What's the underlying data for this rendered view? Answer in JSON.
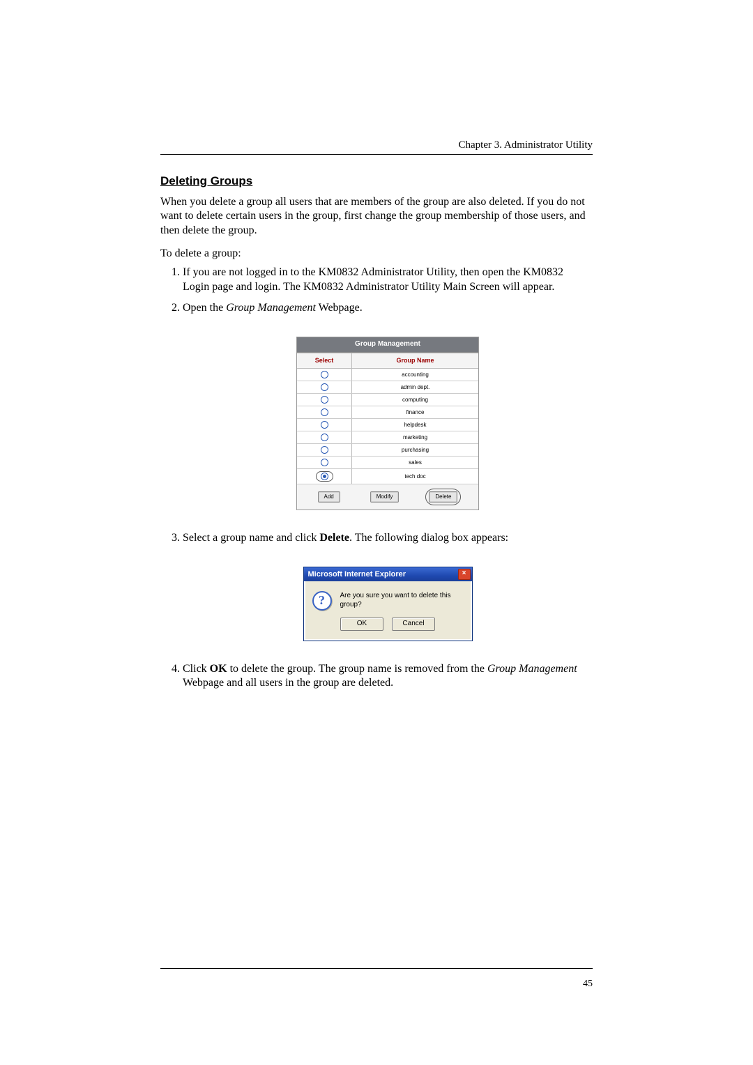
{
  "chapter_line": "Chapter 3. Administrator Utility",
  "heading": "Deleting Groups",
  "para1": "When you delete a group all users that are members of the group are also deleted. If you do not want to delete certain users in the group, first change the group membership of those users, and then delete the group.",
  "intro": "To delete a group:",
  "step1": "If you are not logged in to the KM0832 Administrator Utility, then open the KM0832 Login page and login. The KM0832 Administrator Utility Main Screen will appear.",
  "step2_pre": "Open the ",
  "step2_em": "Group Management",
  "step2_post": " Webpage.",
  "gm_title": "Group Management",
  "gm_col_select": "Select",
  "gm_col_name": "Group Name",
  "gm_rows": [
    "accounting",
    "admin dept.",
    "computing",
    "finance",
    "helpdesk",
    "marketing",
    "purchasing",
    "sales",
    "tech doc"
  ],
  "gm_btn_add": "Add",
  "gm_btn_modify": "Modify",
  "gm_btn_delete": "Delete",
  "step3_pre": "Select a group name and click ",
  "step3_bold": "Delete",
  "step3_post": ". The following dialog box appears:",
  "dlg_title": "Microsoft Internet Explorer",
  "dlg_msg": "Are you sure you want to delete this group?",
  "dlg_ok": "OK",
  "dlg_cancel": "Cancel",
  "step4_pre": "Click ",
  "step4_bold": "OK",
  "step4_mid": " to delete the group. The group name is removed from the ",
  "step4_em": "Group Management",
  "step4_post": " Webpage and all users in the group are deleted.",
  "page_number": "45"
}
